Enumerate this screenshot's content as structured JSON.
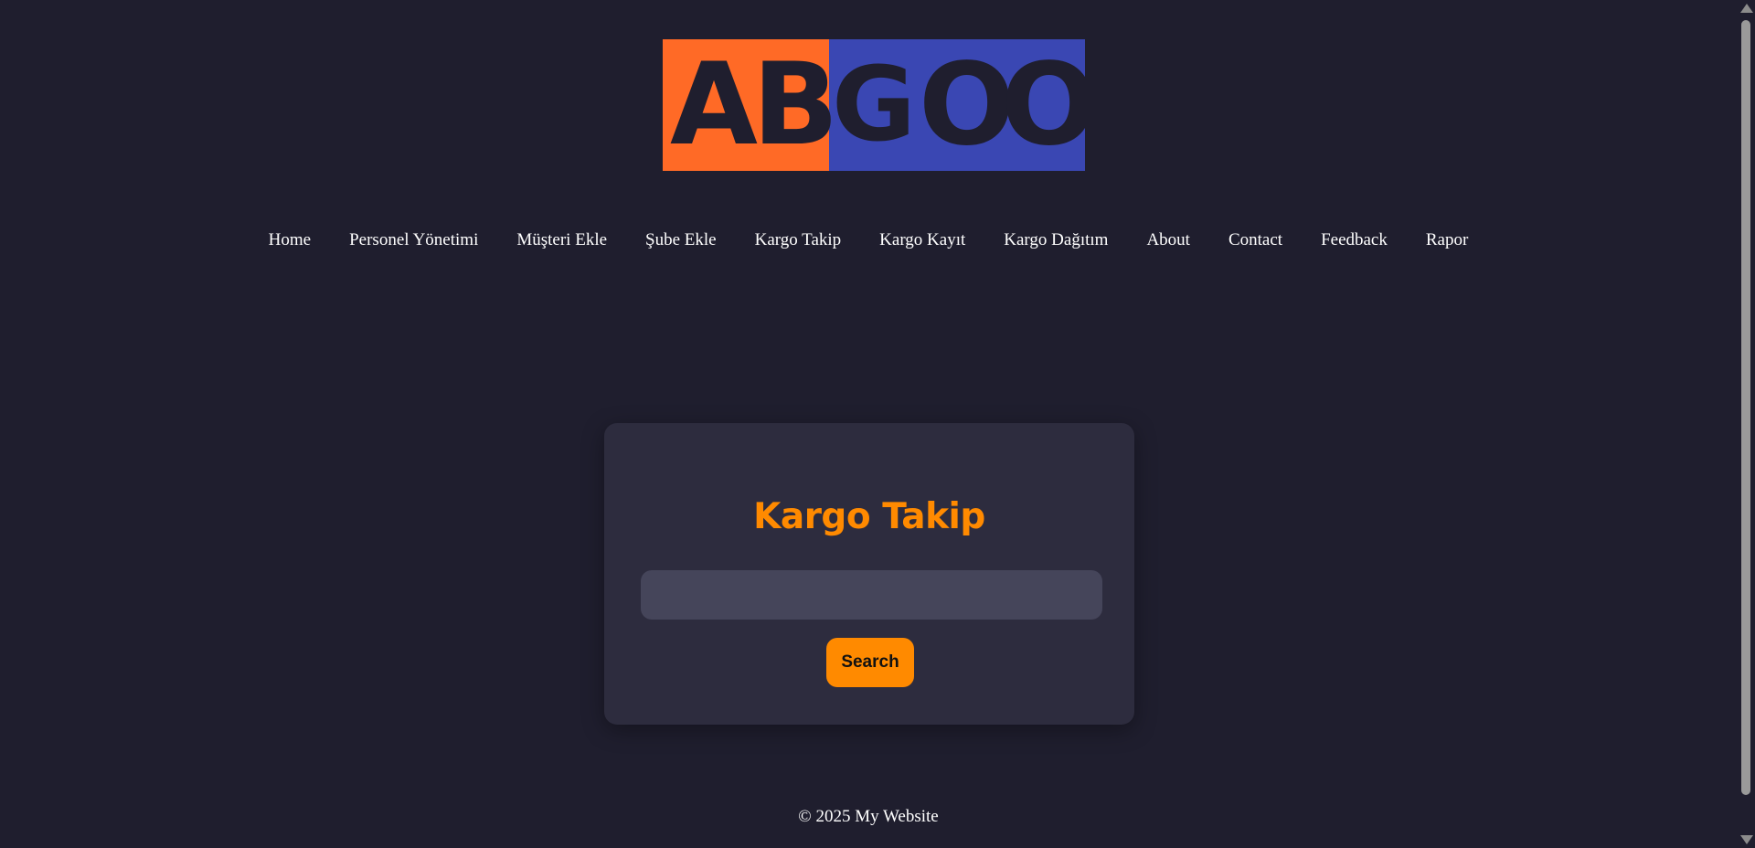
{
  "logo": {
    "letters": [
      "A",
      "B",
      "G",
      "O",
      "O"
    ],
    "colors": {
      "left": "#ff6a26",
      "right": "#3a47b3",
      "text": "#1f1e2e"
    }
  },
  "nav": {
    "items": [
      {
        "label": "Home"
      },
      {
        "label": "Personel Yönetimi"
      },
      {
        "label": "Müşteri Ekle"
      },
      {
        "label": "Şube Ekle"
      },
      {
        "label": "Kargo Takip"
      },
      {
        "label": "Kargo Kayıt"
      },
      {
        "label": "Kargo Dağıtım"
      },
      {
        "label": "About"
      },
      {
        "label": "Contact"
      },
      {
        "label": "Feedback"
      },
      {
        "label": "Rapor"
      }
    ]
  },
  "tracking": {
    "title": "Kargo Takip",
    "input_value": "",
    "input_placeholder": "",
    "search_label": "Search"
  },
  "footer": {
    "text": "© 2025 My Website"
  },
  "theme": {
    "background": "#1f1e2e",
    "card": "#2d2c3e",
    "accent": "#ff8a00",
    "input": "#45455a"
  }
}
